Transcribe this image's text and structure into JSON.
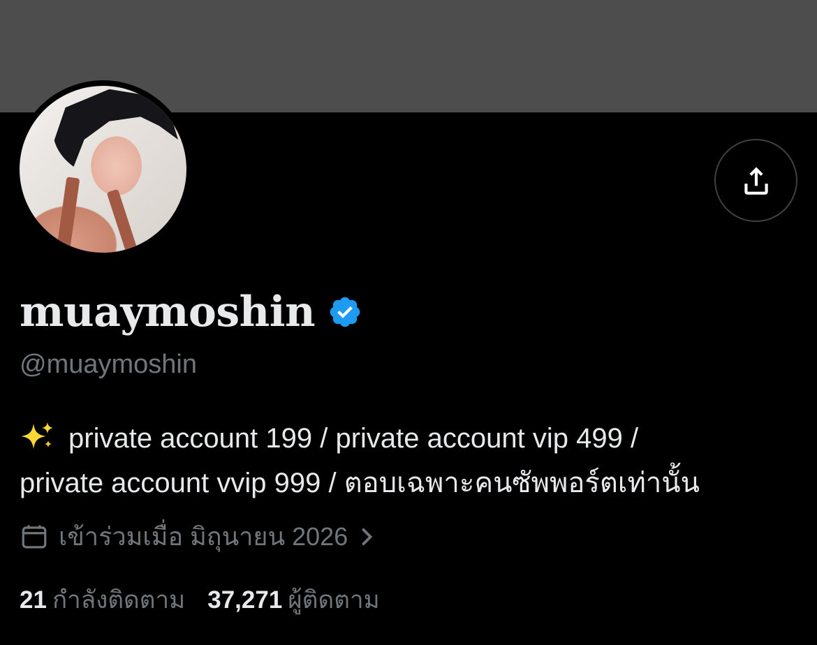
{
  "profile": {
    "display_name": "muaymoshin",
    "handle": "@muaymoshin",
    "verified_icon": "verified-badge-icon",
    "bio_line_1": "private account 199 / private account vip 499 /",
    "bio_line_2": "private account vvip 999 / ตอบเฉพาะคนซัพพอร์ตเท่านั้น",
    "bio_emoji": "sparkles-icon",
    "joined": "เข้าร่วมเมื่อ มิถุนายน 2026",
    "following_count": "21",
    "following_label": "กำลังติดตาม",
    "followers_count": "37,271",
    "followers_label": "ผู้ติดตาม"
  },
  "icons": {
    "share": "share-icon",
    "calendar": "calendar-icon",
    "chevron": "chevron-right-icon"
  },
  "colors": {
    "banner": "#4d4d4d",
    "background": "#000000",
    "primary_text": "#e7e9ea",
    "secondary_text": "#71767b",
    "verified_blue": "#1d9bf0"
  }
}
